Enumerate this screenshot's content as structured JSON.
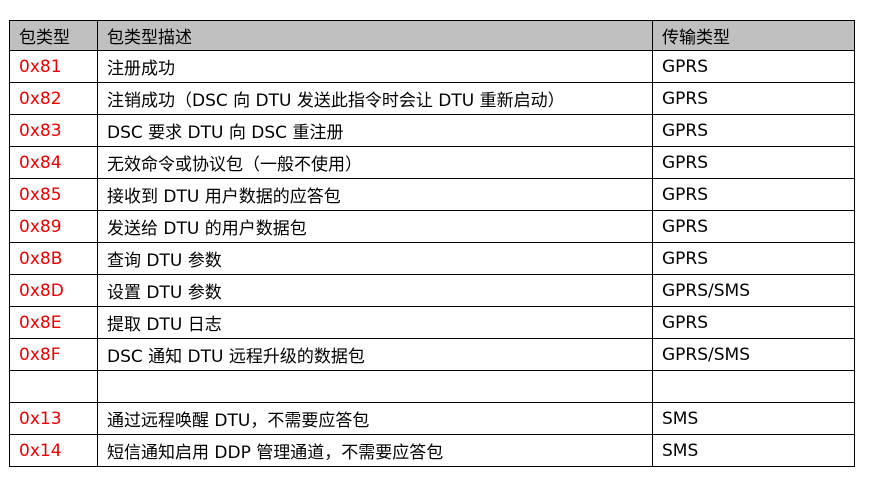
{
  "table": {
    "headers": [
      "包类型",
      "包类型描述",
      "传输类型"
    ],
    "code_color": "#ee0000",
    "header_bg": "#c0c0c0",
    "rows": [
      {
        "code": "0x81",
        "desc": "注册成功",
        "type": "GPRS"
      },
      {
        "code": "0x82",
        "desc": "注销成功（DSC 向 DTU 发送此指令时会让 DTU 重新启动）",
        "type": "GPRS"
      },
      {
        "code": "0x83",
        "desc": "DSC 要求 DTU 向 DSC 重注册",
        "type": "GPRS"
      },
      {
        "code": "0x84",
        "desc": "无效命令或协议包（一般不使用）",
        "type": "GPRS"
      },
      {
        "code": "0x85",
        "desc": "接收到 DTU 用户数据的应答包",
        "type": "GPRS"
      },
      {
        "code": "0x89",
        "desc": "发送给 DTU 的用户数据包",
        "type": "GPRS"
      },
      {
        "code": "0x8B",
        "desc": "查询 DTU 参数",
        "type": "GPRS"
      },
      {
        "code": "0x8D",
        "desc": "设置 DTU 参数",
        "type": "GPRS/SMS"
      },
      {
        "code": "0x8E",
        "desc": "提取 DTU 日志",
        "type": "GPRS"
      },
      {
        "code": "0x8F",
        "desc": "DSC 通知 DTU 远程升级的数据包",
        "type": "GPRS/SMS"
      },
      {
        "code": "",
        "desc": "",
        "type": ""
      },
      {
        "code": "0x13",
        "desc": "通过远程唤醒 DTU，不需要应答包",
        "type": "SMS"
      },
      {
        "code": "0x14",
        "desc": "短信通知启用 DDP 管理通道，不需要应答包",
        "type": "SMS"
      }
    ]
  }
}
